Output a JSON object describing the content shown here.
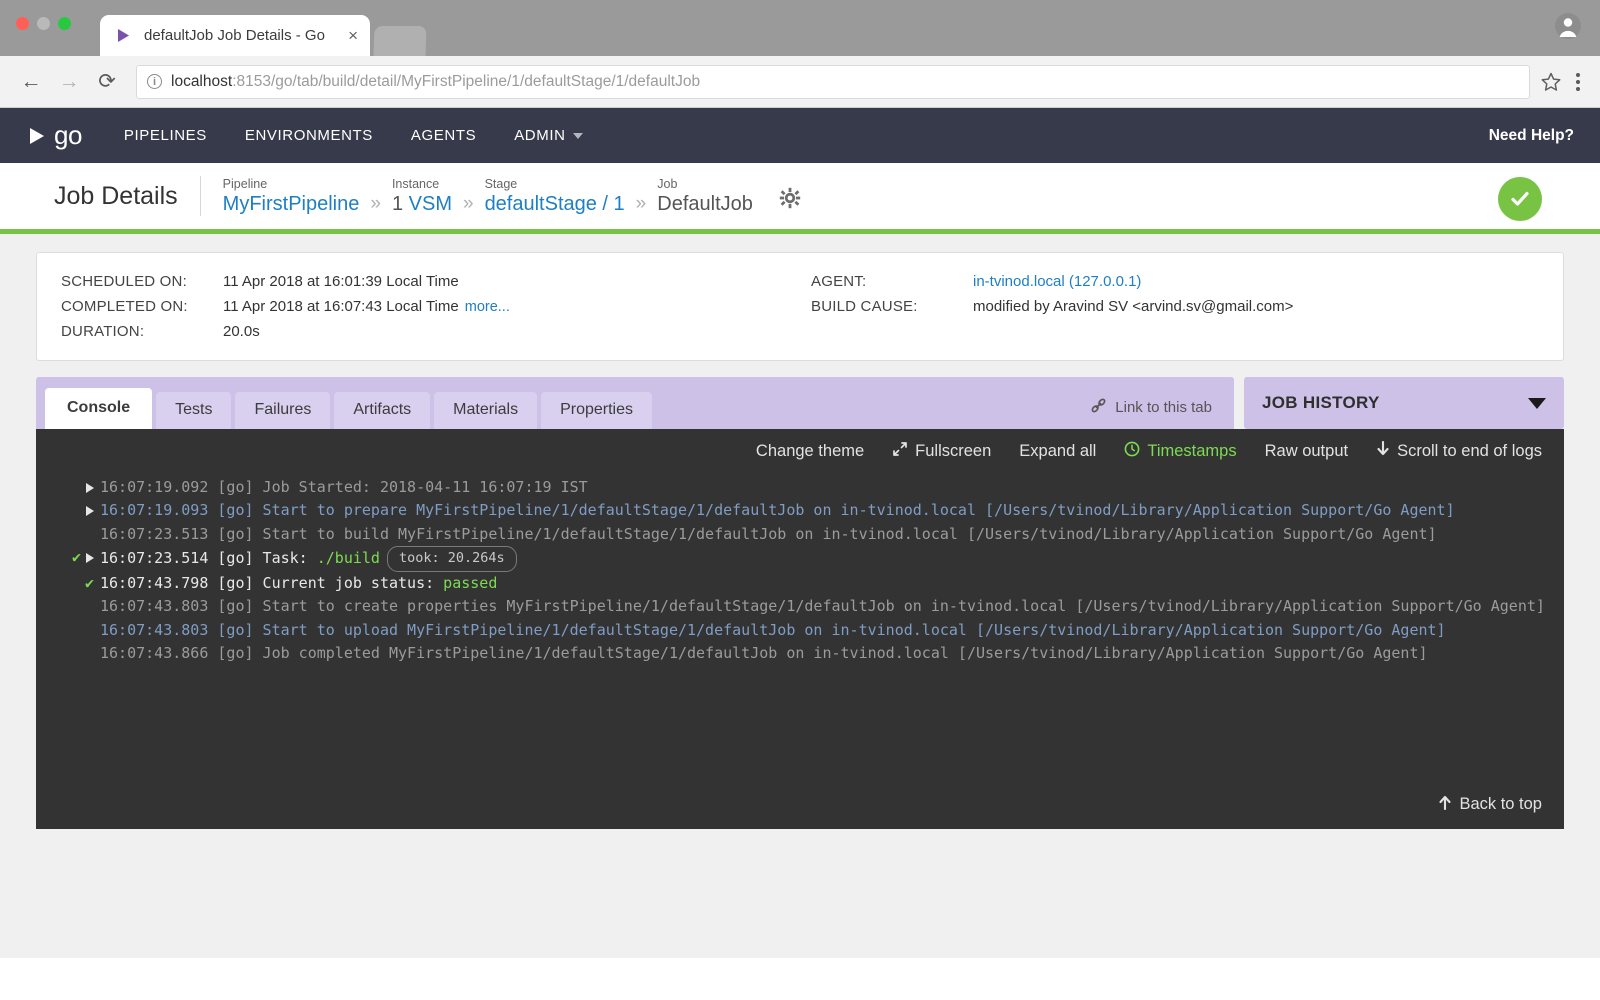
{
  "browser": {
    "tab_title": "defaultJob Job Details - Go",
    "tab_close": "×",
    "url_host": "localhost",
    "url_rest": ":8153/go/tab/build/detail/MyFirstPipeline/1/defaultStage/1/defaultJob",
    "info_glyph": "i",
    "back_glyph": "←",
    "forward_glyph": "→",
    "reload_glyph": "⟳"
  },
  "topnav": {
    "logo_text": "go",
    "links": [
      {
        "label": "PIPELINES"
      },
      {
        "label": "ENVIRONMENTS"
      },
      {
        "label": "AGENTS"
      },
      {
        "label": "ADMIN"
      }
    ],
    "need_help": "Need Help?"
  },
  "header": {
    "title": "Job Details",
    "crumbs": [
      {
        "label": "Pipeline",
        "value": "MyFirstPipeline",
        "link": true
      },
      {
        "label": "Instance",
        "value": "1 ",
        "sub": "VSM",
        "link": false
      },
      {
        "label": "Stage",
        "value": "defaultStage / 1",
        "link": true
      },
      {
        "label": "Job",
        "value": "DefaultJob",
        "link": false
      }
    ],
    "separator": "»",
    "status": "passed"
  },
  "info": {
    "left": [
      {
        "key": "SCHEDULED ON:",
        "value": "11 Apr 2018 at 16:01:39 Local Time"
      },
      {
        "key": "COMPLETED ON:",
        "value": "11 Apr 2018 at 16:07:43 Local Time",
        "more": "more..."
      },
      {
        "key": "DURATION:",
        "value": "20.0s"
      }
    ],
    "right": [
      {
        "key": "AGENT:",
        "value": "in-tvinod.local (127.0.0.1)",
        "link": true
      },
      {
        "key": "BUILD CAUSE:",
        "value": "modified by Aravind SV <arvind.sv@gmail.com>",
        "link": false
      }
    ]
  },
  "tabs": {
    "items": [
      {
        "label": "Console",
        "active": true
      },
      {
        "label": "Tests",
        "active": false
      },
      {
        "label": "Failures",
        "active": false
      },
      {
        "label": "Artifacts",
        "active": false
      },
      {
        "label": "Materials",
        "active": false
      },
      {
        "label": "Properties",
        "active": false
      }
    ],
    "link_to_tab": "Link to this tab",
    "job_history": "JOB HISTORY"
  },
  "console": {
    "toolbar": [
      {
        "label": "Change theme",
        "icon": null,
        "green": false
      },
      {
        "label": "Fullscreen",
        "icon": "⤢",
        "green": false
      },
      {
        "label": "Expand all",
        "icon": null,
        "green": false
      },
      {
        "label": "Timestamps",
        "icon": "⊙",
        "green": true
      },
      {
        "label": "Raw output",
        "icon": null,
        "green": false
      },
      {
        "label": "Scroll to end of logs",
        "icon": "↓",
        "green": false
      }
    ],
    "back_to_top": "Back to top",
    "back_to_top_icon": "↑",
    "lines": [
      {
        "tick": false,
        "triangle": true,
        "color": "gray",
        "text": "16:07:19.092 [go] Job Started: 2018-04-11 16:07:19 IST"
      },
      {
        "tick": false,
        "triangle": true,
        "color": "blue",
        "text": "16:07:19.093 [go] Start to prepare MyFirstPipeline/1/defaultStage/1/defaultJob on in-tvinod.local [/Users/tvinod/Library/Application Support/Go Agent]"
      },
      {
        "tick": false,
        "triangle": false,
        "color": "gray",
        "text": "16:07:23.513 [go] Start to build MyFirstPipeline/1/defaultStage/1/defaultJob on in-tvinod.local [/Users/tvinod/Library/Application Support/Go Agent]"
      },
      {
        "tick": true,
        "triangle": true,
        "color": "white",
        "text": "16:07:23.514 [go] Task: ",
        "highlight": "./build",
        "badge": "took: 20.264s"
      },
      {
        "tick": true,
        "triangle": false,
        "color": "white",
        "text": "16:07:43.798 [go] Current job status: ",
        "highlight": "passed"
      },
      {
        "tick": false,
        "triangle": false,
        "color": "gray",
        "text": "16:07:43.803 [go] Start to create properties MyFirstPipeline/1/defaultStage/1/defaultJob on in-tvinod.local [/Users/tvinod/Library/Application Support/Go Agent]"
      },
      {
        "tick": false,
        "triangle": false,
        "color": "blue",
        "text": "16:07:43.803 [go] Start to upload MyFirstPipeline/1/defaultStage/1/defaultJob on in-tvinod.local [/Users/tvinod/Library/Application Support/Go Agent]"
      },
      {
        "tick": false,
        "triangle": false,
        "color": "gray",
        "text": "16:07:43.866 [go] Job completed MyFirstPipeline/1/defaultStage/1/defaultJob on in-tvinod.local [/Users/tvinod/Library/Application Support/Go Agent]"
      }
    ]
  },
  "colors": {
    "nav_bg": "#373a4a",
    "accent_green": "#78c344",
    "tab_purple": "#cdc1e8",
    "link_blue": "#1e7fc4",
    "console_bg": "#333333"
  }
}
